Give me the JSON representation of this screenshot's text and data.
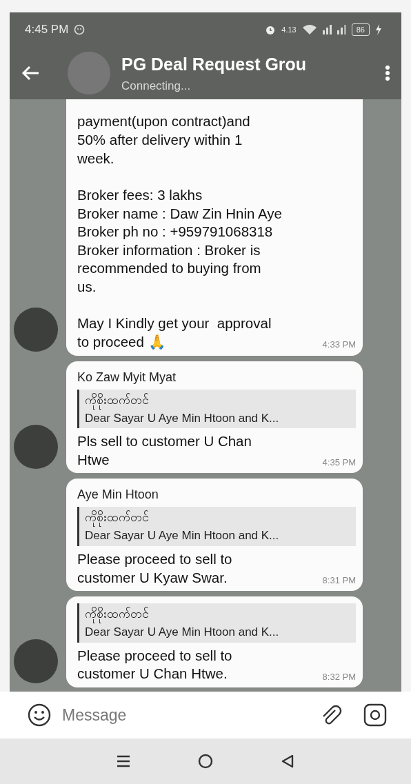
{
  "status_bar": {
    "time": "4:45 PM",
    "net_speed": "4.13",
    "battery": "86"
  },
  "header": {
    "title": "PG Deal Request Grou",
    "status": "Connecting..."
  },
  "messages": [
    {
      "text": "payment(upon contract)and\n50% after delivery within 1\nweek.\n\nBroker fees: 3 lakhs\nBroker name : Daw Zin Hnin Aye\nBroker ph no : +959791068318\nBroker information : Broker is\nrecommended to buying from\nus.\n\nMay I Kindly get your  approval\nto proceed 🙏",
      "time": "4:33 PM",
      "avatar": true
    },
    {
      "sender": "Ko Zaw Myit Myat",
      "reply": {
        "author": "ကိုစိုးထက်တင်",
        "text": "Dear Sayar U Aye Min Htoon and K..."
      },
      "text": "Pls sell to customer U Chan\nHtwe",
      "time": "4:35 PM",
      "avatar": true
    },
    {
      "sender": "Aye Min Htoon",
      "reply": {
        "author": "ကိုစိုးထက်တင်",
        "text": "Dear Sayar U Aye Min Htoon and K..."
      },
      "text": "Please proceed to sell to\ncustomer U Kyaw Swar.",
      "time": "8:31 PM",
      "avatar": false
    },
    {
      "reply": {
        "author": "ကိုစိုးထက်တင်",
        "text": "Dear Sayar U Aye Min Htoon and K..."
      },
      "text": "Please proceed to sell to\ncustomer U Chan Htwe.",
      "time": "8:32 PM",
      "avatar": true
    }
  ],
  "composer": {
    "placeholder": "Message"
  }
}
